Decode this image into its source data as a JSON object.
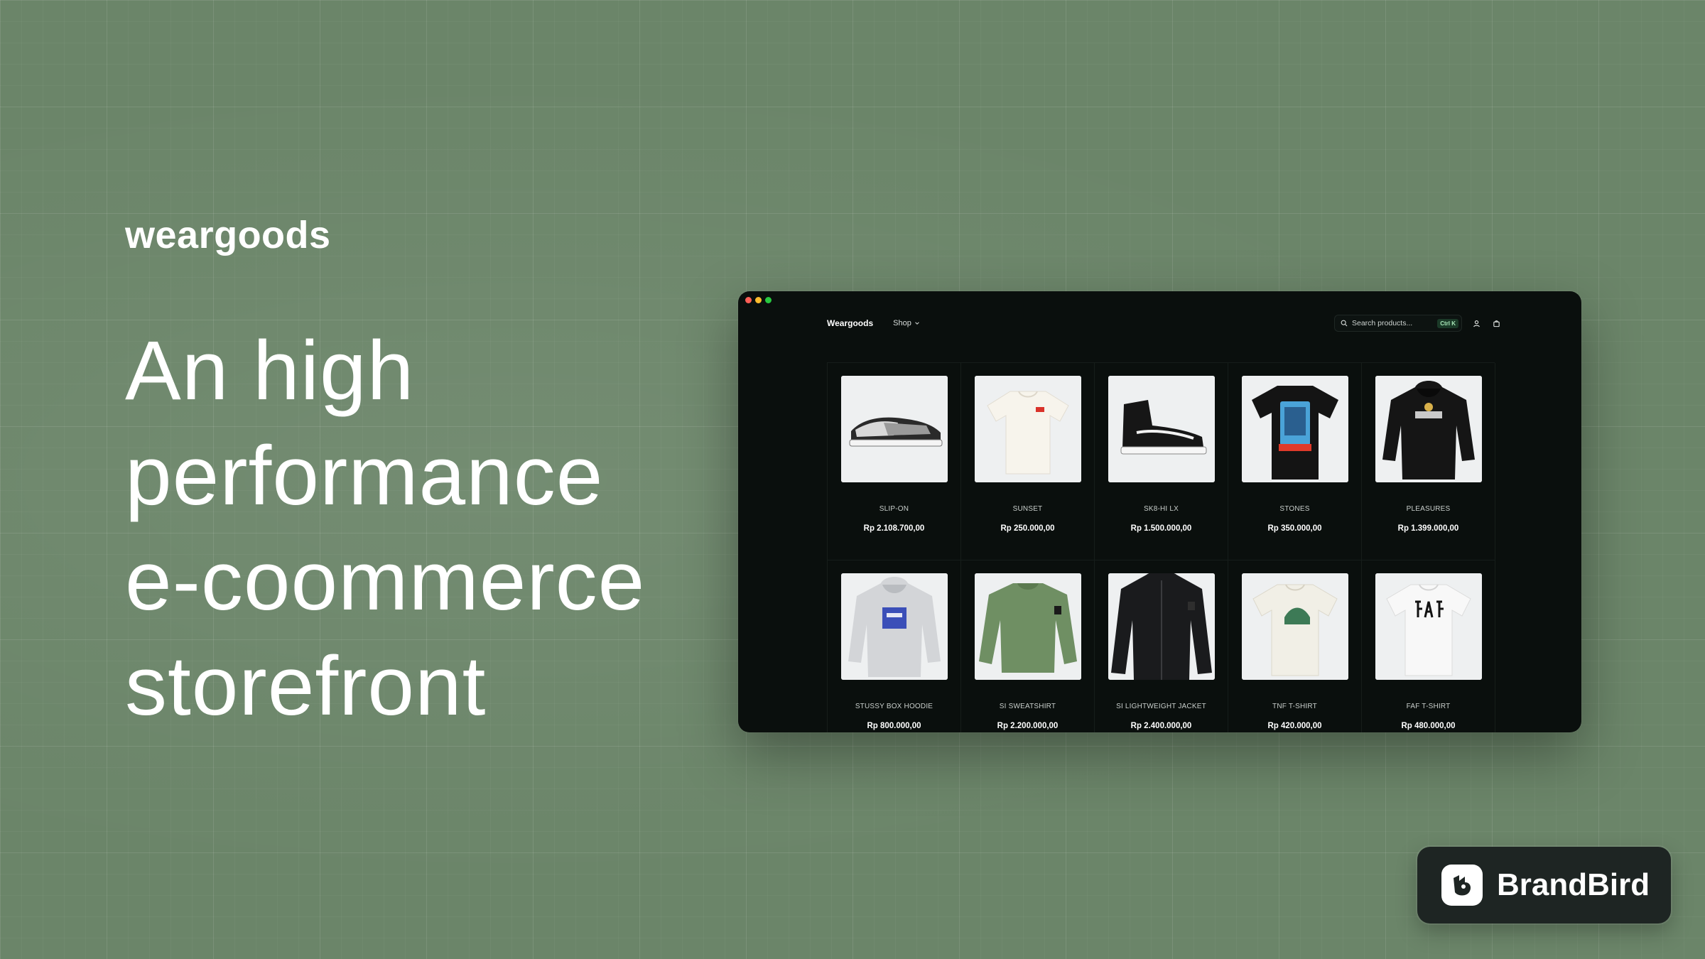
{
  "hero": {
    "brand": "weargoods",
    "headline_lines": [
      "An high",
      "performance",
      "e-coommerce",
      "storefront"
    ]
  },
  "store": {
    "logo": "Weargoods",
    "shop_label": "Shop",
    "search_placeholder": "Search products...",
    "search_shortcut": "Ctrl K",
    "products": [
      {
        "name": "SLIP-ON",
        "price": "Rp 2.108.700,00"
      },
      {
        "name": "SUNSET",
        "price": "Rp 250.000,00"
      },
      {
        "name": "SK8-HI LX",
        "price": "Rp 1.500.000,00"
      },
      {
        "name": "STONES",
        "price": "Rp 350.000,00"
      },
      {
        "name": "PLEASURES",
        "price": "Rp 1.399.000,00"
      },
      {
        "name": "STUSSY BOX HOODIE",
        "price": "Rp 800.000,00"
      },
      {
        "name": "SI SWEATSHIRT",
        "price": "Rp 2.200.000,00"
      },
      {
        "name": "SI LIGHTWEIGHT JACKET",
        "price": "Rp 2.400.000,00"
      },
      {
        "name": "TNF T-SHIRT",
        "price": "Rp 420.000,00"
      },
      {
        "name": "FAF T-SHIRT",
        "price": "Rp 480.000,00"
      }
    ]
  },
  "badge": {
    "label": "BrandBird"
  },
  "icons": {
    "search": "search-icon",
    "user": "user-icon",
    "cart": "cart-icon",
    "chevron": "chevron-down-icon",
    "brand": "brandbird-logo-icon"
  },
  "colors": {
    "background": "#6b8569",
    "window": "#0a0f0d",
    "accent": "#a8e6b8"
  }
}
